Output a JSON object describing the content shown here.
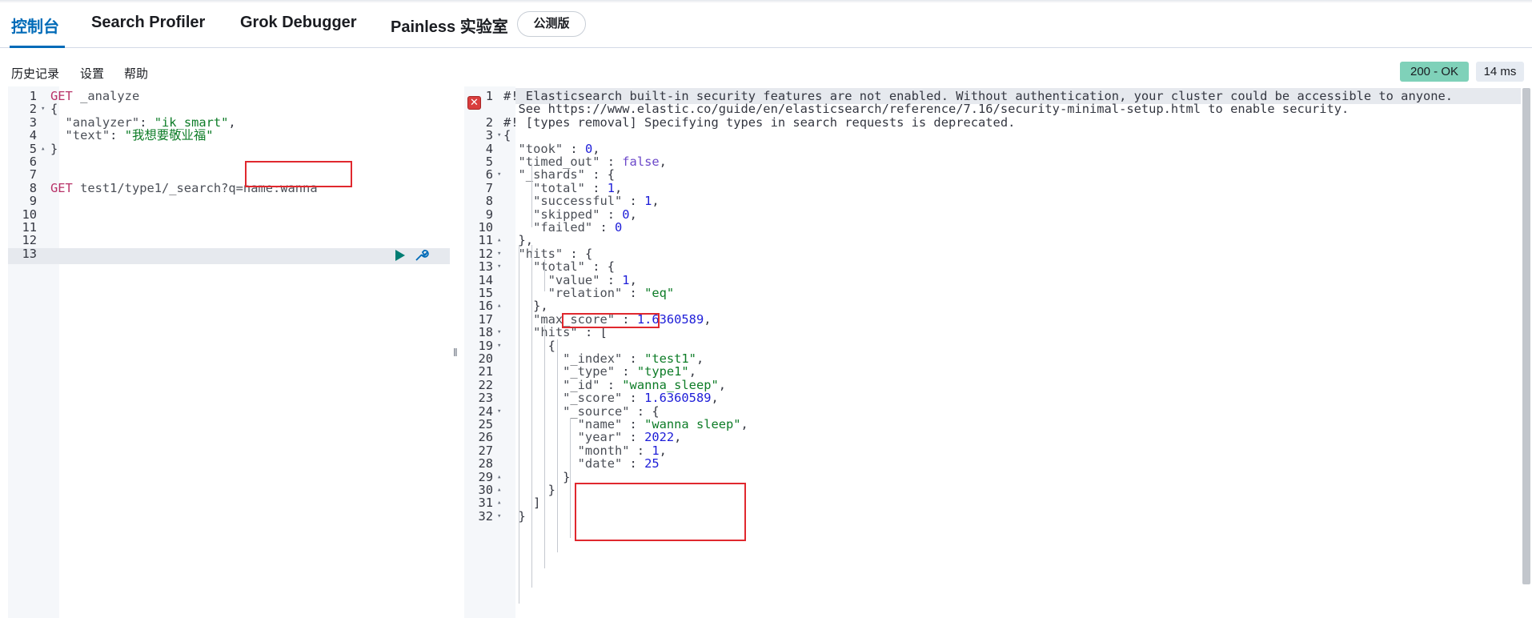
{
  "tabs": [
    {
      "label": "控制台"
    },
    {
      "label": "Search Profiler"
    },
    {
      "label": "Grok Debugger"
    },
    {
      "label": "Painless 实验室"
    }
  ],
  "beta_badge": "公测版",
  "menu": {
    "history": "历史记录",
    "settings": "设置",
    "help": "帮助"
  },
  "status": {
    "code": "200 - OK",
    "time": "14 ms"
  },
  "request": {
    "line_numbers": [
      "1",
      "2",
      "3",
      "4",
      "5",
      "6",
      "7",
      "8",
      "9",
      "10",
      "11",
      "12",
      "13"
    ],
    "lines": [
      [
        {
          "t": "GET",
          "c": "k"
        },
        {
          "t": " _analyze",
          "c": "m"
        }
      ],
      [
        {
          "t": "{",
          "c": "p"
        }
      ],
      [
        {
          "t": "  \"analyzer\"",
          "c": "m"
        },
        {
          "t": ": ",
          "c": "p"
        },
        {
          "t": "\"ik_smart\"",
          "c": "s"
        },
        {
          "t": ",",
          "c": "p"
        }
      ],
      [
        {
          "t": "  \"text\"",
          "c": "m"
        },
        {
          "t": ": ",
          "c": "p"
        },
        {
          "t": "\"我想要敬业福\"",
          "c": "s"
        }
      ],
      [
        {
          "t": "}",
          "c": "p"
        }
      ],
      [],
      [],
      [
        {
          "t": "GET",
          "c": "k"
        },
        {
          "t": " test1/type1/_search?q=name:wanna",
          "c": "m"
        }
      ],
      [],
      [],
      [],
      [],
      []
    ]
  },
  "response": {
    "line_numbers": [
      "1",
      "",
      "2",
      "3",
      "4",
      "5",
      "6",
      "7",
      "8",
      "9",
      "10",
      "11",
      "12",
      "13",
      "14",
      "15",
      "16",
      "17",
      "18",
      "19",
      "20",
      "21",
      "22",
      "23",
      "24",
      "25",
      "26",
      "27",
      "28",
      "29",
      "30",
      "31",
      "32"
    ],
    "lines": [
      [
        {
          "t": "#! Elasticsearch built-in security features are not enabled. Without authentication, your cluster could be accessible to anyone.",
          "c": "p"
        }
      ],
      [
        {
          "t": "  See https://www.elastic.co/guide/en/elasticsearch/reference/7.16/security-minimal-setup.html to enable security.",
          "c": "p"
        }
      ],
      [
        {
          "t": "#! [types removal] Specifying types in search requests is deprecated.",
          "c": "p"
        }
      ],
      [
        {
          "t": "{",
          "c": "p"
        }
      ],
      [
        {
          "t": "  \"took\"",
          "c": "m"
        },
        {
          "t": " : ",
          "c": "p"
        },
        {
          "t": "0",
          "c": "n"
        },
        {
          "t": ",",
          "c": "p"
        }
      ],
      [
        {
          "t": "  \"timed_out\"",
          "c": "m"
        },
        {
          "t": " : ",
          "c": "p"
        },
        {
          "t": "false",
          "c": "b"
        },
        {
          "t": ",",
          "c": "p"
        }
      ],
      [
        {
          "t": "  \"_shards\"",
          "c": "m"
        },
        {
          "t": " : {",
          "c": "p"
        }
      ],
      [
        {
          "t": "    \"total\"",
          "c": "m"
        },
        {
          "t": " : ",
          "c": "p"
        },
        {
          "t": "1",
          "c": "n"
        },
        {
          "t": ",",
          "c": "p"
        }
      ],
      [
        {
          "t": "    \"successful\"",
          "c": "m"
        },
        {
          "t": " : ",
          "c": "p"
        },
        {
          "t": "1",
          "c": "n"
        },
        {
          "t": ",",
          "c": "p"
        }
      ],
      [
        {
          "t": "    \"skipped\"",
          "c": "m"
        },
        {
          "t": " : ",
          "c": "p"
        },
        {
          "t": "0",
          "c": "n"
        },
        {
          "t": ",",
          "c": "p"
        }
      ],
      [
        {
          "t": "    \"failed\"",
          "c": "m"
        },
        {
          "t": " : ",
          "c": "p"
        },
        {
          "t": "0",
          "c": "n"
        }
      ],
      [
        {
          "t": "  },",
          "c": "p"
        }
      ],
      [
        {
          "t": "  \"hits\"",
          "c": "m"
        },
        {
          "t": " : {",
          "c": "p"
        }
      ],
      [
        {
          "t": "    \"total\"",
          "c": "m"
        },
        {
          "t": " : {",
          "c": "p"
        }
      ],
      [
        {
          "t": "      \"value\"",
          "c": "m"
        },
        {
          "t": " : ",
          "c": "p"
        },
        {
          "t": "1",
          "c": "n"
        },
        {
          "t": ",",
          "c": "p"
        }
      ],
      [
        {
          "t": "      \"relation\"",
          "c": "m"
        },
        {
          "t": " : ",
          "c": "p"
        },
        {
          "t": "\"eq\"",
          "c": "s"
        }
      ],
      [
        {
          "t": "    },",
          "c": "p"
        }
      ],
      [
        {
          "t": "    \"max_score\"",
          "c": "m"
        },
        {
          "t": " : ",
          "c": "p"
        },
        {
          "t": "1.6360589",
          "c": "n"
        },
        {
          "t": ",",
          "c": "p"
        }
      ],
      [
        {
          "t": "    \"hits\"",
          "c": "m"
        },
        {
          "t": " : [",
          "c": "p"
        }
      ],
      [
        {
          "t": "      {",
          "c": "p"
        }
      ],
      [
        {
          "t": "        \"_index\"",
          "c": "m"
        },
        {
          "t": " : ",
          "c": "p"
        },
        {
          "t": "\"test1\"",
          "c": "s"
        },
        {
          "t": ",",
          "c": "p"
        }
      ],
      [
        {
          "t": "        \"_type\"",
          "c": "m"
        },
        {
          "t": " : ",
          "c": "p"
        },
        {
          "t": "\"type1\"",
          "c": "s"
        },
        {
          "t": ",",
          "c": "p"
        }
      ],
      [
        {
          "t": "        \"_id\"",
          "c": "m"
        },
        {
          "t": " : ",
          "c": "p"
        },
        {
          "t": "\"wanna_sleep\"",
          "c": "s"
        },
        {
          "t": ",",
          "c": "p"
        }
      ],
      [
        {
          "t": "        \"_score\"",
          "c": "m"
        },
        {
          "t": " : ",
          "c": "p"
        },
        {
          "t": "1.6360589",
          "c": "n"
        },
        {
          "t": ",",
          "c": "p"
        }
      ],
      [
        {
          "t": "        \"_source\"",
          "c": "m"
        },
        {
          "t": " : {",
          "c": "p"
        }
      ],
      [
        {
          "t": "          \"name\"",
          "c": "m"
        },
        {
          "t": " : ",
          "c": "p"
        },
        {
          "t": "\"wanna sleep\"",
          "c": "s"
        },
        {
          "t": ",",
          "c": "p"
        }
      ],
      [
        {
          "t": "          \"year\"",
          "c": "m"
        },
        {
          "t": " : ",
          "c": "p"
        },
        {
          "t": "2022",
          "c": "n"
        },
        {
          "t": ",",
          "c": "p"
        }
      ],
      [
        {
          "t": "          \"month\"",
          "c": "m"
        },
        {
          "t": " : ",
          "c": "p"
        },
        {
          "t": "1",
          "c": "n"
        },
        {
          "t": ",",
          "c": "p"
        }
      ],
      [
        {
          "t": "          \"date\"",
          "c": "m"
        },
        {
          "t": " : ",
          "c": "p"
        },
        {
          "t": "25",
          "c": "n"
        }
      ],
      [
        {
          "t": "        }",
          "c": "p"
        }
      ],
      [
        {
          "t": "      }",
          "c": "p"
        }
      ],
      [
        {
          "t": "    ]",
          "c": "p"
        }
      ],
      [
        {
          "t": "  }",
          "c": "p"
        }
      ]
    ]
  }
}
